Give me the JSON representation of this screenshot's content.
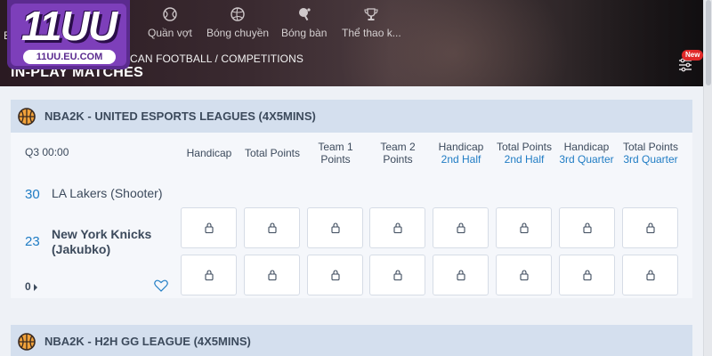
{
  "logo": {
    "main": "11UU",
    "domain": "11UU.EU.COM"
  },
  "nav": {
    "side_letter": "E",
    "tabs": [
      {
        "label": "Quần vợt",
        "icon": "tennis-ball-icon"
      },
      {
        "label": "Bóng chuyền",
        "icon": "volleyball-icon"
      },
      {
        "label": "Bóng bàn",
        "icon": "ping-pong-icon"
      },
      {
        "label": "Thể thao k...",
        "icon": "trophy-icon"
      }
    ]
  },
  "breadcrumb": "CAN FOOTBALL / COMPETITIONS",
  "page_title": "IN-PLAY MATCHES",
  "filter": {
    "badge": "New",
    "icon": "filter-sliders-icon"
  },
  "colors": {
    "accent": "#1f7cc4",
    "league_bar": "#d4dfee",
    "badge": "#e02828",
    "logo": "#7d3fba"
  },
  "leagues": [
    {
      "name": "NBA2K - UNITED ESPORTS LEAGUES (4X5MINS)",
      "icon": "basketball-icon",
      "clock": "Q3 00:00",
      "markets": [
        {
          "line1": "Handicap",
          "line2": ""
        },
        {
          "line1": "Total Points",
          "line2": ""
        },
        {
          "line1": "Team 1",
          "line2": "Points"
        },
        {
          "line1": "Team 2",
          "line2": "Points"
        },
        {
          "line1": "Handicap",
          "line2": "2nd Half"
        },
        {
          "line1": "Total Points",
          "line2": "2nd Half"
        },
        {
          "line1": "Handicap",
          "line2": "3rd Quarter"
        },
        {
          "line1": "Total Points",
          "line2": "3rd Quarter"
        }
      ],
      "teams": [
        {
          "score": "30",
          "name": "LA Lakers (Shooter)"
        },
        {
          "score": "23",
          "name": "New York Knicks (Jakubko)"
        }
      ],
      "more_count": "0",
      "locked_icon": "lock-icon"
    },
    {
      "name": "NBA2K - H2H GG LEAGUE (4X5MINS)",
      "icon": "basketball-icon"
    }
  ]
}
